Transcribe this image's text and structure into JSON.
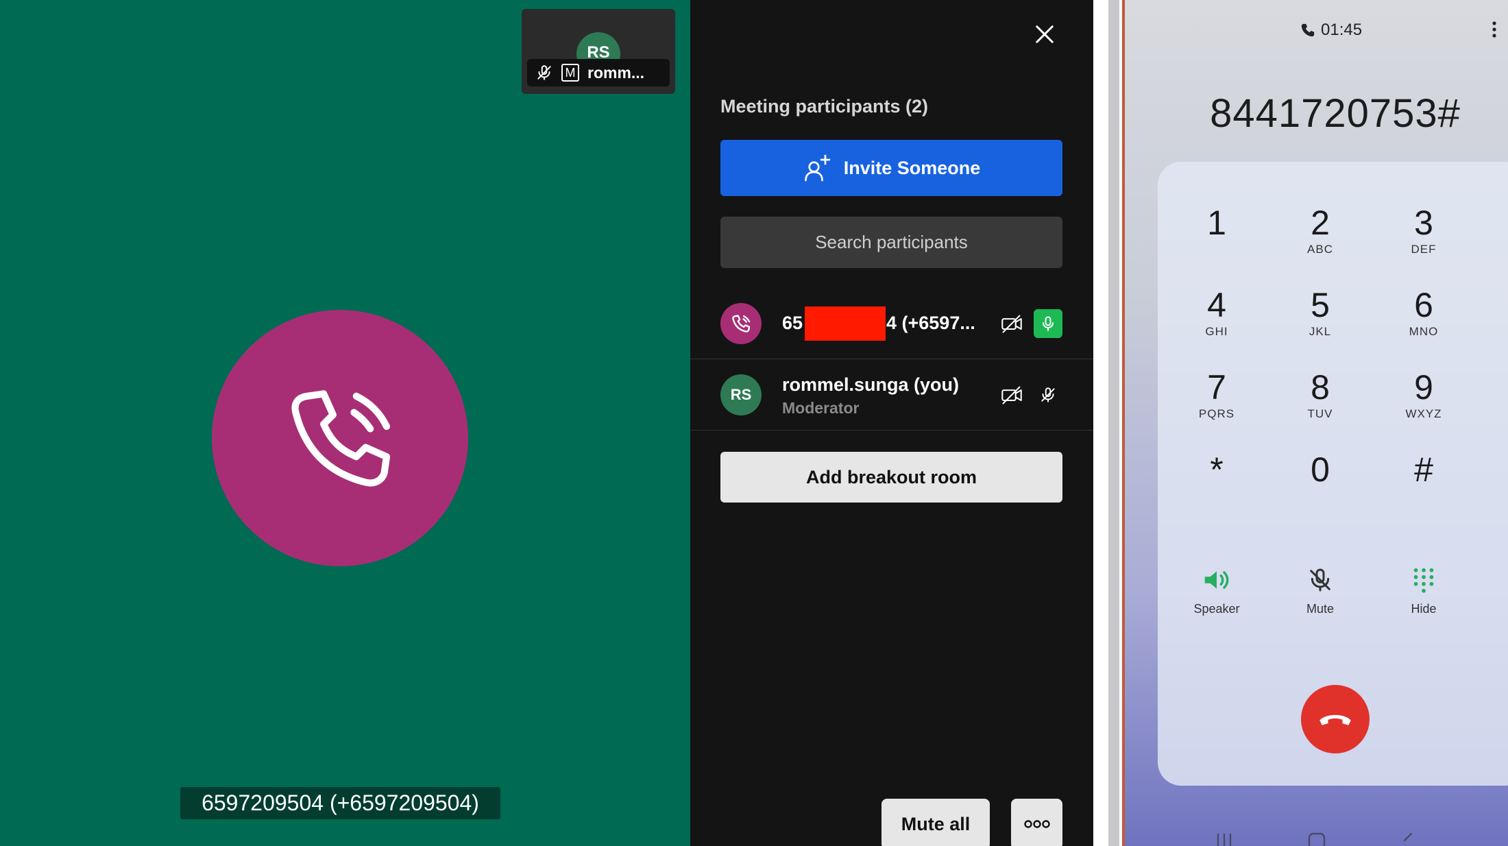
{
  "stage": {
    "caller_caption": "6597209504 (+6597209504)",
    "caller_icon": "phone-call-icon",
    "self_tile": {
      "initials": "RS",
      "name": "romm...",
      "badge": "M"
    }
  },
  "panel": {
    "title": "Meeting participants (2)",
    "invite_label": "Invite Someone",
    "search_placeholder": "Search participants",
    "participants": [
      {
        "name_prefix": "65",
        "name_suffix": "4 (+6597...",
        "icon": "phone-call-icon",
        "camera": "camera-off-icon",
        "mic": "mic-on-icon"
      },
      {
        "initials": "RS",
        "name": "rommel.sunga (you)",
        "role": "Moderator",
        "camera": "camera-off-icon",
        "mic": "mic-off-icon"
      }
    ],
    "breakout_label": "Add breakout room",
    "mute_all_label": "Mute all",
    "more_icon": "more-options-icon"
  },
  "phone": {
    "timer": "01:45",
    "dialed_number": "8441720753#",
    "keys": [
      {
        "digit": "1",
        "letters": ""
      },
      {
        "digit": "2",
        "letters": "ABC"
      },
      {
        "digit": "3",
        "letters": "DEF"
      },
      {
        "digit": "4",
        "letters": "GHI"
      },
      {
        "digit": "5",
        "letters": "JKL"
      },
      {
        "digit": "6",
        "letters": "MNO"
      },
      {
        "digit": "7",
        "letters": "PQRS"
      },
      {
        "digit": "8",
        "letters": "TUV"
      },
      {
        "digit": "9",
        "letters": "WXYZ"
      },
      {
        "digit": "*",
        "letters": ""
      },
      {
        "digit": "0",
        "letters": ""
      },
      {
        "digit": "#",
        "letters": ""
      }
    ],
    "controls": {
      "speaker": "Speaker",
      "mute": "Mute",
      "hide": "Hide"
    }
  },
  "colors": {
    "stage_green": "#006a52",
    "caller_magenta": "#a72e75",
    "invite_blue": "#1862e0",
    "mic_active_green": "#1db954",
    "end_call_red": "#e0322b",
    "redaction_red": "#ff1a00"
  }
}
